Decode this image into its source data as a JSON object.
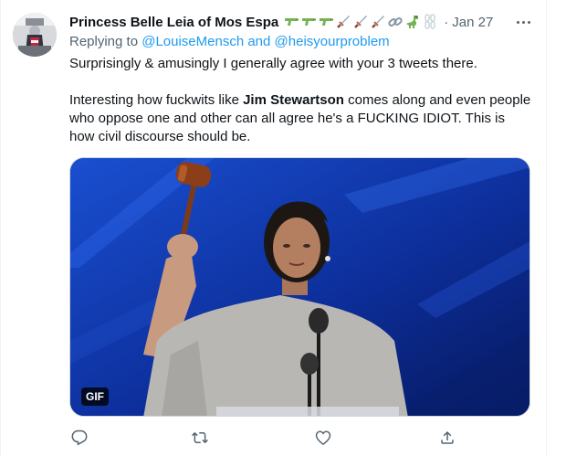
{
  "tweet": {
    "display_name": "Princess Belle Leia of Mos Espa",
    "name_emojis": [
      "water-pistol-icon",
      "water-pistol-icon",
      "water-pistol-icon",
      "dagger-icon",
      "dagger-icon",
      "dagger-icon",
      "link-icon",
      "t-rex-icon",
      "chains-icon"
    ],
    "separator": "·",
    "date": "Jan 27",
    "replying_prefix": "Replying to",
    "reply_to_1": "@LouiseMensch",
    "reply_and": "and",
    "reply_to_2": "@heisyourproblem",
    "paragraph_1": "Surprisingly & amusingly I generally agree with your 3 tweets there.",
    "paragraph_2_before": "Interesting how fuckwits like ",
    "paragraph_2_bold": "Jim Stewartson",
    "paragraph_2_after": " comes along and even people who oppose one and other can all agree he's a FUCKING IDIOT. This is how civil discourse should be.",
    "media_badge": "GIF"
  },
  "actions": [
    "reply-icon",
    "retweet-icon",
    "like-icon",
    "share-icon"
  ],
  "colors": {
    "link": "#1d9bf0",
    "secondary_text": "#536471",
    "primary_text": "#0f1419",
    "gif_background": "#0b2a8a"
  }
}
